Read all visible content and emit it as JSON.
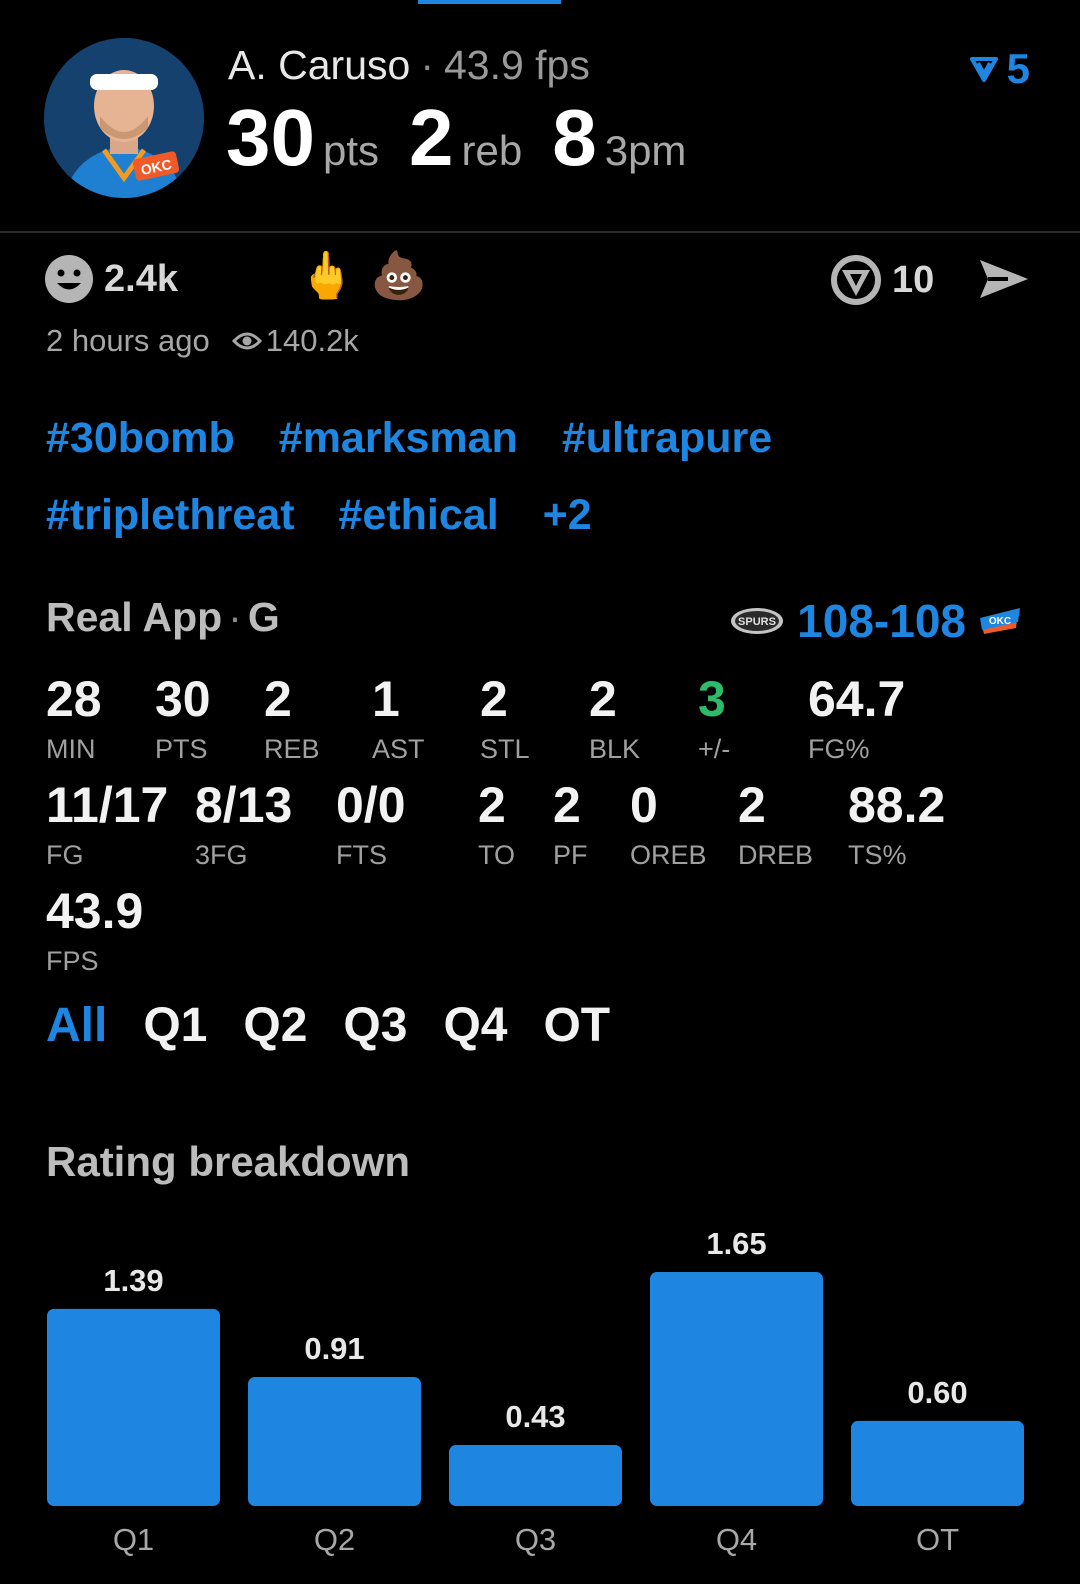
{
  "header": {
    "player_name": "A. Caruso",
    "separator": "·",
    "fps_text": "43.9 fps",
    "pts_value": "30",
    "pts_unit": "pts",
    "reb_value": "2",
    "reb_unit": "reb",
    "threes_value": "8",
    "threes_unit": "3pm",
    "vote_count": "5",
    "avatar_team_text": "OKC"
  },
  "reactions": {
    "smile_count": "2.4k",
    "emoji_1": "🖕",
    "emoji_2": "💩",
    "comment_count": "10"
  },
  "meta": {
    "time_ago": "2 hours ago",
    "views": "140.2k"
  },
  "tags": {
    "row1": [
      "#30bomb",
      "#marksman",
      "#ultrapure"
    ],
    "row2": [
      "#triplethreat",
      "#ethical",
      "+2"
    ]
  },
  "game": {
    "app_name": "Real App",
    "separator": "·",
    "position": "G",
    "score": "108-108",
    "team_left": "SPURS",
    "team_right": "OKC"
  },
  "stats": {
    "row1": [
      {
        "value": "28",
        "label": "MIN"
      },
      {
        "value": "30",
        "label": "PTS"
      },
      {
        "value": "2",
        "label": "REB"
      },
      {
        "value": "1",
        "label": "AST"
      },
      {
        "value": "2",
        "label": "STL"
      },
      {
        "value": "2",
        "label": "BLK"
      },
      {
        "value": "3",
        "label": "+/-"
      },
      {
        "value": "64.7",
        "label": "FG%"
      }
    ],
    "row2": [
      {
        "value": "11/17",
        "label": "FG"
      },
      {
        "value": "8/13",
        "label": "3FG"
      },
      {
        "value": "0/0",
        "label": "FTS"
      },
      {
        "value": "2",
        "label": "TO"
      },
      {
        "value": "2",
        "label": "PF"
      },
      {
        "value": "0",
        "label": "OREB"
      },
      {
        "value": "2",
        "label": "DREB"
      },
      {
        "value": "88.2",
        "label": "TS%"
      }
    ],
    "row3": [
      {
        "value": "43.9",
        "label": "FPS"
      }
    ]
  },
  "quarter_tabs": [
    "All",
    "Q1",
    "Q2",
    "Q3",
    "Q4",
    "OT"
  ],
  "rating_title": "Rating breakdown",
  "colors": {
    "accent": "#1e86e0",
    "positive": "#2dbb6a",
    "background": "#000000"
  },
  "chart_data": {
    "type": "bar",
    "categories": [
      "Q1",
      "Q2",
      "Q3",
      "Q4",
      "OT"
    ],
    "values": [
      1.39,
      0.91,
      0.43,
      1.65,
      0.6
    ],
    "value_labels": [
      "1.39",
      "0.91",
      "0.43",
      "1.65",
      "0.60"
    ],
    "title": "Rating breakdown",
    "ylim": [
      0,
      1.65
    ],
    "grid": false
  }
}
